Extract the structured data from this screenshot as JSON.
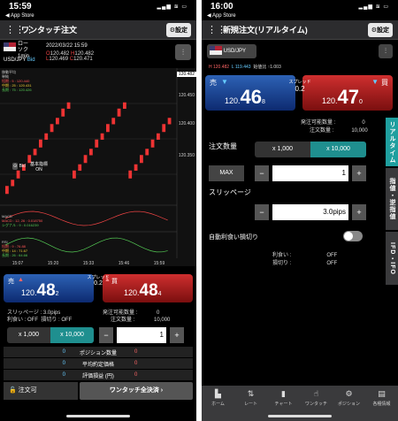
{
  "left": {
    "status": {
      "time": "15:59",
      "back": "◀ App Store"
    },
    "header": {
      "title": "ワンタッチ注文",
      "settings": "設定"
    },
    "symbol": {
      "name1": "ローソク",
      "name2": "1min",
      "pair": "USD/JPY",
      "side": "Bid",
      "datetime": "2022/03/22 15:59",
      "o_label": "O",
      "o": "120.482",
      "h_label": "H",
      "h": "120.482",
      "l_label": "L",
      "l": "120.469",
      "c_label": "C",
      "c": "120.471"
    },
    "chart": {
      "ma_title": "移動平均",
      "ma_sub": "単純",
      "ma1": "短期 : 5 : 120.440",
      "ma2": "中期 : 25 : 120.431",
      "ma3": "長期 : 75 : 120.426",
      "y_ticks": [
        "120.482",
        "120.450",
        "120.400",
        "120.350"
      ],
      "bid_label": "Bid",
      "basis_label": "基本指標",
      "basis_state": "ON",
      "macd_title": "MACD",
      "macd_line": "MACD : 12, 26 : 0.018750",
      "macd_signal": "シグナル : 9 : 0.016239",
      "rsi_title": "RSI",
      "rsi1": "短期 : 9 : 76.88",
      "rsi2": "中期 : 14 : 71.67",
      "rsi3": "長期 : 26 : 64.66",
      "x_ticks": [
        "15:07",
        "15:20",
        "15:33",
        "15:46",
        "15:59"
      ],
      "chart_series": {
        "price_range": [
          120.34,
          120.5
        ],
        "candles": [
          [
            120.35,
            120.358
          ],
          [
            120.36,
            120.366
          ],
          [
            120.37,
            120.378
          ],
          [
            120.38,
            120.386
          ],
          [
            120.39,
            120.398
          ],
          [
            120.4,
            120.406
          ],
          [
            120.41,
            120.418
          ],
          [
            120.42,
            120.426
          ],
          [
            120.43,
            120.438
          ],
          [
            120.44,
            120.446
          ],
          [
            120.45,
            120.458
          ],
          [
            120.46,
            120.466
          ],
          [
            120.37,
            120.378
          ],
          [
            120.38,
            120.386
          ],
          [
            120.39,
            120.398
          ],
          [
            120.4,
            120.406
          ],
          [
            120.41,
            120.418
          ],
          [
            120.42,
            120.426
          ],
          [
            120.43,
            120.438
          ],
          [
            120.44,
            120.446
          ],
          [
            120.45,
            120.458
          ],
          [
            120.46,
            120.466
          ],
          [
            120.37,
            120.378
          ],
          [
            120.38,
            120.386
          ],
          [
            120.39,
            120.398
          ],
          [
            120.4,
            120.406
          ],
          [
            120.41,
            120.418
          ],
          [
            120.42,
            120.426
          ],
          [
            120.43,
            120.438
          ],
          [
            120.44,
            120.446
          ]
        ]
      }
    },
    "price": {
      "sell": "売",
      "buy": "買",
      "spread_label": "スプレッド",
      "spread": "0.2",
      "sell_s": "120.",
      "sell_b": "48",
      "sell_t": "2",
      "buy_s": "120.",
      "buy_b": "48",
      "buy_t": "4"
    },
    "info": {
      "slip_label": "スリッページ :",
      "slip": "3.0pips",
      "avail_label": "発注可能数量 :",
      "avail": "0",
      "auto_label": "利食い : OFF",
      "sl_label": "損切り : OFF",
      "order_label": "注文数量 :",
      "order": "10,000"
    },
    "lots": {
      "a": "x 1,000",
      "b": "x 10,000",
      "qty": "1",
      "minus": "−",
      "plus": "+"
    },
    "pos": {
      "r1_l": "0",
      "r1_t": "ポジション数量",
      "r1_r": "0",
      "r2_l": "0",
      "r2_t": "平均約定価格",
      "r2_r": "0",
      "r3_l": "0",
      "r3_t": "評価損益 (円)",
      "r3_r": "0"
    },
    "bottom": {
      "order_ok": "注文可",
      "close_all": "ワンタッチ全決済"
    }
  },
  "right": {
    "status": {
      "time": "16:00",
      "back": "◀ App Store"
    },
    "header": {
      "title": "新規注文(リアルタイム)",
      "settings": "設定"
    },
    "pair": "USD/JPY",
    "hl": {
      "h": "H 120.482",
      "l": "L 119.443",
      "chg": "始値比 ↑1.003"
    },
    "price": {
      "sell": "売",
      "buy": "買",
      "spread_label": "スプレッド",
      "spread": "0.2",
      "sell_s": "120.",
      "sell_b": "46",
      "sell_t": "8",
      "buy_s": "120.",
      "buy_b": "47",
      "buy_t": "0"
    },
    "info": {
      "avail_label": "発注可能数量 :",
      "avail": "0",
      "order_label": "注文数量 :",
      "order": "10,000"
    },
    "qty": {
      "label": "注文数量",
      "a": "x 1,000",
      "b": "x 10,000",
      "max": "MAX",
      "value": "1",
      "minus": "−",
      "plus": "+"
    },
    "slip": {
      "label": "スリッページ",
      "value": "3.0pips",
      "minus": "−",
      "plus": "+"
    },
    "auto": {
      "label": "自動利食い損切り",
      "p_label": "利食い :",
      "p_val": "OFF",
      "l_label": "損切り :",
      "l_val": "OFF"
    },
    "side_tabs": [
      "リアルタイム",
      "指値・逆指値",
      "IFD・IFO"
    ],
    "tabbar": [
      {
        "icon": "▙",
        "label": "ホーム"
      },
      {
        "icon": "⇅",
        "label": "レート"
      },
      {
        "icon": "▮",
        "label": "チャート"
      },
      {
        "icon": "☝",
        "label": "ワンタッチ"
      },
      {
        "icon": "⚙",
        "label": "ポジション"
      },
      {
        "icon": "▤",
        "label": "各種情報"
      }
    ]
  },
  "colors": {
    "sell": "#1f4fa5",
    "buy": "#b11f1f",
    "teal": "#1f8f8f",
    "accent": "#2fc0c0"
  }
}
